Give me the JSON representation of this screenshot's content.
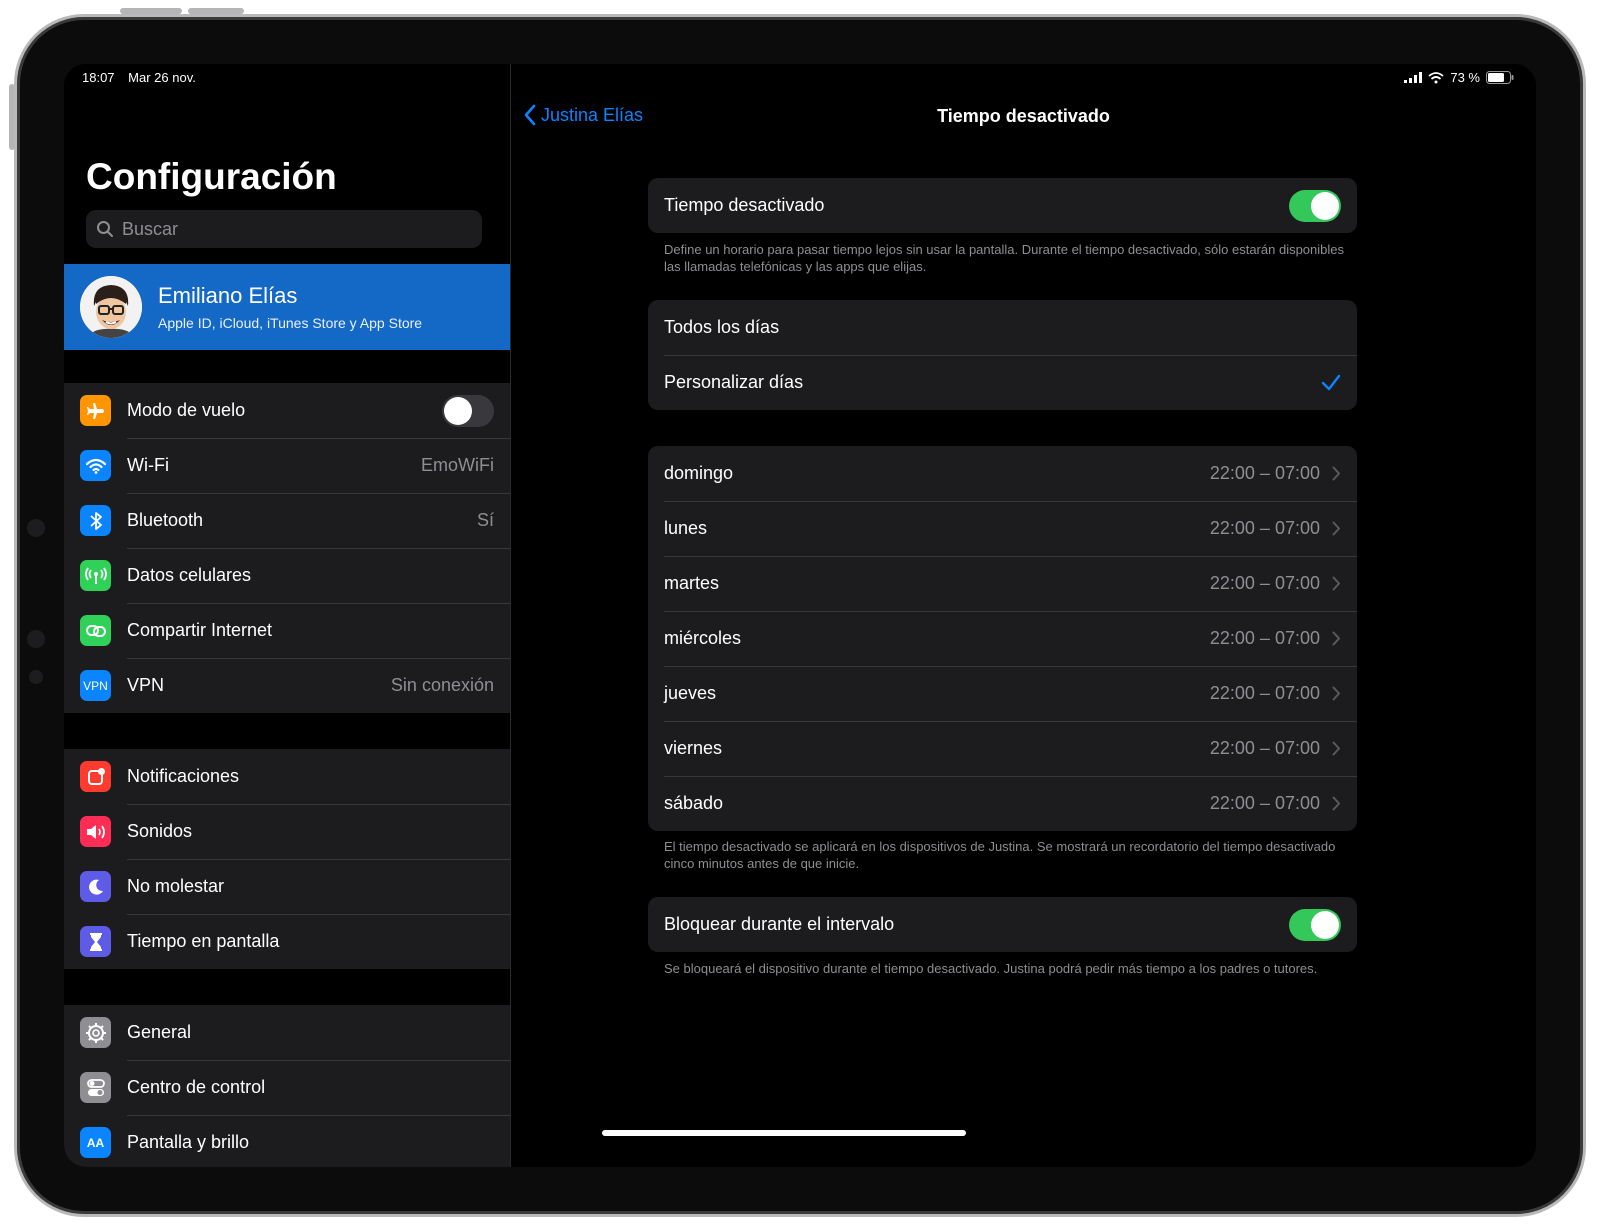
{
  "status": {
    "time": "18:07",
    "date": "Mar 26 nov.",
    "battery": "73 %"
  },
  "sidebar": {
    "title": "Configuración",
    "search_placeholder": "Buscar",
    "profile": {
      "name": "Emiliano Elías",
      "subtitle": "Apple ID, iCloud, iTunes Store y App Store"
    },
    "group1": [
      {
        "label": "Modo de vuelo",
        "icon": "airplane-icon",
        "color": "#ff9500",
        "toggle": false
      },
      {
        "label": "Wi-Fi",
        "value": "EmoWiFi",
        "icon": "wifi-icon",
        "color": "#0a84ff"
      },
      {
        "label": "Bluetooth",
        "value": "Sí",
        "icon": "bluetooth-icon",
        "color": "#0a84ff"
      },
      {
        "label": "Datos celulares",
        "icon": "cellular-icon",
        "color": "#30d158"
      },
      {
        "label": "Compartir Internet",
        "icon": "hotspot-icon",
        "color": "#30d158"
      },
      {
        "label": "VPN",
        "value": "Sin conexión",
        "icon": "vpn-icon",
        "icon_text": "VPN",
        "color": "#0a84ff"
      }
    ],
    "group2": [
      {
        "label": "Notificaciones",
        "icon": "notifications-icon",
        "color": "#ff3b30"
      },
      {
        "label": "Sonidos",
        "icon": "speaker-icon",
        "color": "#ff2d55"
      },
      {
        "label": "No molestar",
        "icon": "moon-icon",
        "color": "#5e5ce6"
      },
      {
        "label": "Tiempo en pantalla",
        "icon": "hourglass-icon",
        "color": "#5e5ce6"
      }
    ],
    "group3": [
      {
        "label": "General",
        "icon": "gear-icon",
        "color": "#8e8e93"
      },
      {
        "label": "Centro de control",
        "icon": "control-center-icon",
        "color": "#8e8e93"
      },
      {
        "label": "Pantalla y brillo",
        "icon": "display-icon",
        "icon_text": "AA",
        "color": "#0a84ff"
      }
    ]
  },
  "detail": {
    "back_label": "Justina Elías",
    "title": "Tiempo desactivado",
    "downtime_label": "Tiempo desactivado",
    "downtime_on": true,
    "downtime_footer": "Define un horario para pasar tiempo lejos sin usar la pantalla. Durante el tiempo desactivado, sólo estarán disponibles las llamadas telefónicas y las apps que elijas.",
    "schedule_options": [
      {
        "label": "Todos los días",
        "selected": false
      },
      {
        "label": "Personalizar días",
        "selected": true
      }
    ],
    "days": [
      {
        "label": "domingo",
        "value": "22:00 – 07:00"
      },
      {
        "label": "lunes",
        "value": "22:00 – 07:00"
      },
      {
        "label": "martes",
        "value": "22:00 – 07:00"
      },
      {
        "label": "miércoles",
        "value": "22:00 – 07:00"
      },
      {
        "label": "jueves",
        "value": "22:00 – 07:00"
      },
      {
        "label": "viernes",
        "value": "22:00 – 07:00"
      },
      {
        "label": "sábado",
        "value": "22:00 – 07:00"
      }
    ],
    "days_footer": "El tiempo desactivado se aplicará en los dispositivos de Justina. Se mostrará un recordatorio del tiempo desactivado cinco minutos antes de que inicie.",
    "block_label": "Bloquear durante el intervalo",
    "block_on": true,
    "block_footer": "Se bloqueará el dispositivo durante el tiempo desactivado. Justina podrá pedir más tiempo a los padres o tutores."
  }
}
